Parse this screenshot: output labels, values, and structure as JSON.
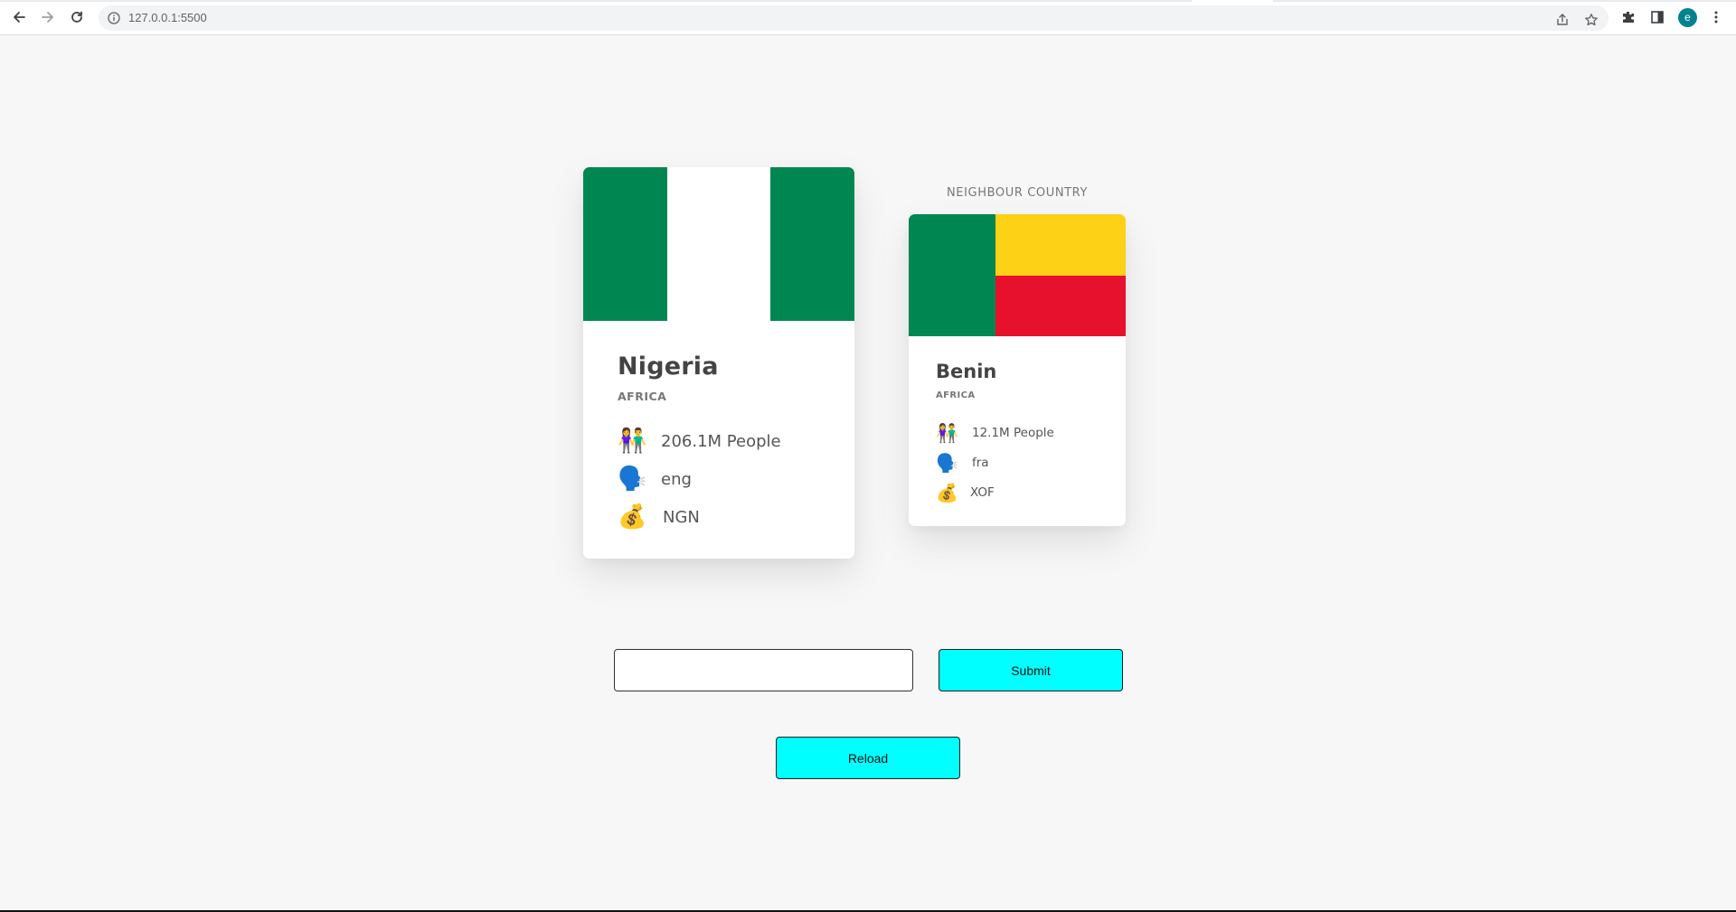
{
  "browser": {
    "url": "127.0.0.1:5500",
    "avatar_letter": "e",
    "icons": [
      "back-icon",
      "forward-icon",
      "reload-icon",
      "info-icon",
      "share-icon",
      "star-icon",
      "extensions-icon",
      "sidepanel-icon",
      "menu-icon"
    ]
  },
  "main_country": {
    "name": "Nigeria",
    "region": "AFRICA",
    "population": "206.1M People",
    "language": "eng",
    "currency": "NGN",
    "flag_colors": [
      "#008751",
      "#ffffff",
      "#008751"
    ]
  },
  "neighbour": {
    "heading": "NEIGHBOUR COUNTRY",
    "name": "Benin",
    "region": "AFRICA",
    "population": "12.1M People",
    "language": "fra",
    "currency": "XOF",
    "flag_colors": [
      "#008751",
      "#fcd116",
      "#e8112d"
    ]
  },
  "icons": {
    "population": "👫",
    "language": "🗣️",
    "currency": "💰"
  },
  "form": {
    "input_value": "",
    "submit_label": "Submit",
    "reload_label": "Reload",
    "accent": "#00ffff"
  }
}
